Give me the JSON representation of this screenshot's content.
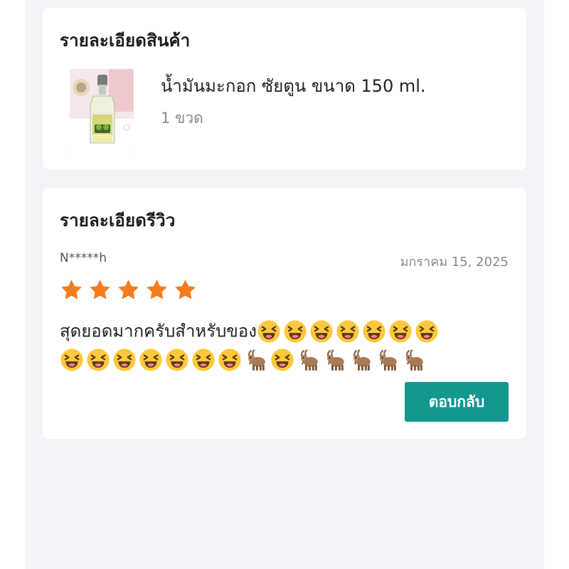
{
  "product_section": {
    "title": "รายละเอียดสินค้า",
    "product": {
      "name": "น้ำมันมะกอก ซัยตูน ขนาด 150 ml.",
      "quantity": "1 ขวด"
    }
  },
  "review_section": {
    "title": "รายละเอียดรีวิว",
    "reviewer": "N*****h",
    "date": "มกราคม 15, 2025",
    "rating": 5,
    "text": "สุดยอดมากครับสำหรับของ",
    "emoji_line1": [
      "laughing-face",
      "laughing-face",
      "laughing-face",
      "laughing-face",
      "laughing-face",
      "laughing-face",
      "laughing-face"
    ],
    "emoji_line2": [
      "laughing-face",
      "laughing-face",
      "laughing-face",
      "laughing-face",
      "laughing-face",
      "laughing-face",
      "laughing-face",
      "goat",
      "laughing-face",
      "goat",
      "goat",
      "goat",
      "goat",
      "goat"
    ],
    "reply_label": "ตอบกลับ"
  },
  "colors": {
    "page_background": "#f3f4f8",
    "card_background": "#ffffff",
    "star": "#f57c1f",
    "reply_button": "#13978f"
  }
}
